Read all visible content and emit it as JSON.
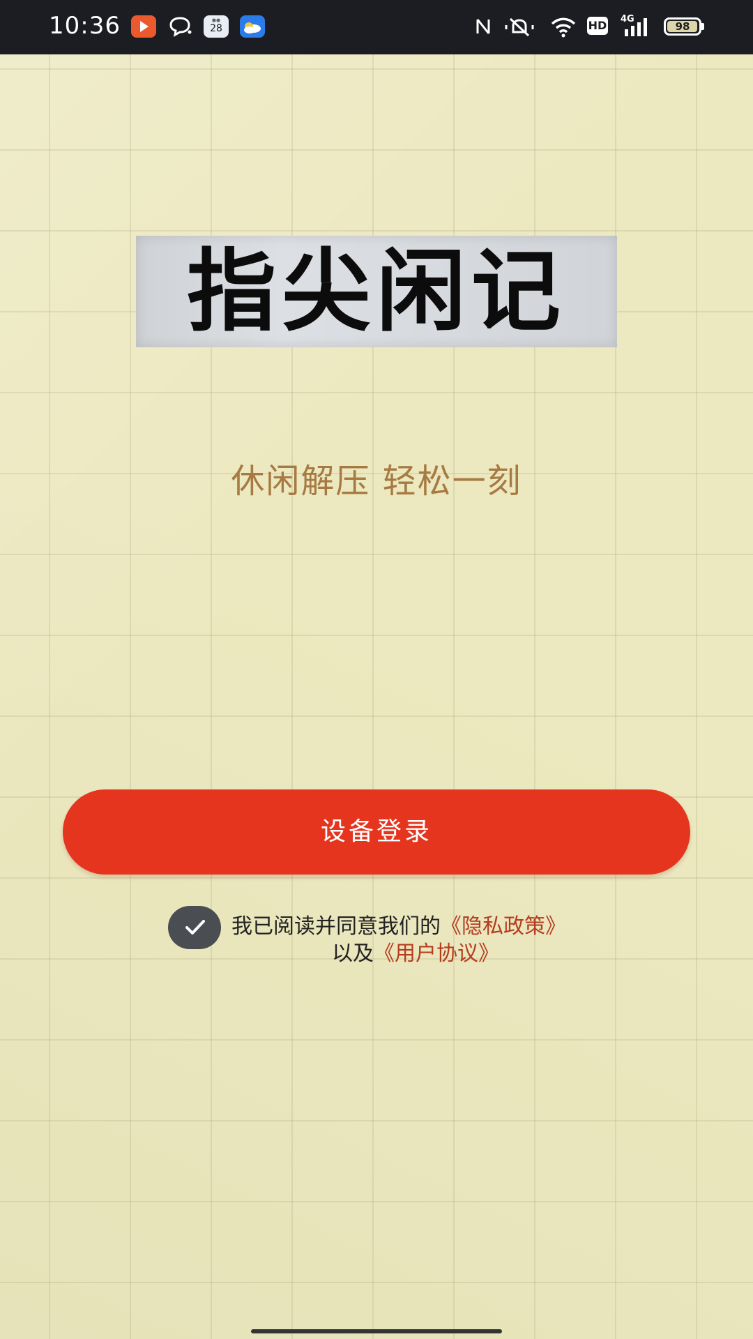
{
  "status_bar": {
    "time": "10:36",
    "calendar_day": "28",
    "network": "4G",
    "hd_label": "HD",
    "battery_level": 98,
    "battery_text": "98"
  },
  "logo": {
    "text": "指尖闲记"
  },
  "tagline": "休闲解压 轻松一刻",
  "login_button": {
    "label": "设备登录"
  },
  "agreement": {
    "checked": true,
    "line1_prefix": "我已阅读并同意我们的",
    "privacy_link": "《隐私政策》",
    "line2_prefix": "以及",
    "terms_link": "《用户协议》"
  },
  "colors": {
    "accent": "#e6351e",
    "tagline": "#a67a42",
    "link": "#b53d1e",
    "paper": "#ece8bf"
  }
}
